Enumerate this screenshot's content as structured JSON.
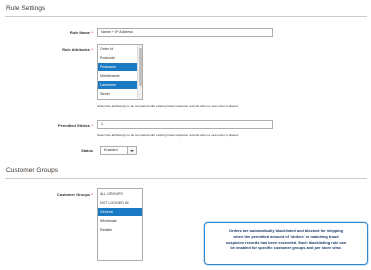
{
  "rule_settings": {
    "title": "Rule Settings",
    "rule_name": {
      "label": "Rule Name",
      "required": "*",
      "value": "Name + IP Address"
    },
    "rule_attributes": {
      "label": "Rule Attributes",
      "required": "*",
      "options": [
        {
          "text": "Order Id",
          "selected": false
        },
        {
          "text": "Postcode",
          "selected": false
        },
        {
          "text": "Firstname",
          "selected": true
        },
        {
          "text": "Middlename",
          "selected": false
        },
        {
          "text": "Lastname",
          "selected": true
        },
        {
          "text": "Street",
          "selected": false
        }
      ],
      "note": "Select the attribute(s) to be compared with existing fraud suspicion records when a new order is placed."
    },
    "permitted_strikes": {
      "label": "Permitted Strikes",
      "required": "*",
      "value": "1",
      "note": "Select the attribute(s) to be compared with existing fraud suspicion records when a new order is placed."
    },
    "status": {
      "label": "Status",
      "value": "Enabled"
    }
  },
  "customer_groups": {
    "title": "Customer Groups",
    "field": {
      "label": "Customer Groups",
      "required": "*",
      "options": [
        {
          "text": "ALL GROUPS",
          "selected": false
        },
        {
          "text": "NOT LOGGED IN",
          "selected": false
        },
        {
          "text": "General",
          "selected": true
        },
        {
          "text": "Wholesale",
          "selected": false
        },
        {
          "text": "Retailer",
          "selected": false
        }
      ]
    }
  },
  "tooltip": {
    "line1": "Orders are automatically blacklisted and blocked for shipping",
    "line2": "when the permitted amount of 'strikes' or matching fraud",
    "line3": "suspicion records has been exceeded. Each blacklisting rule can",
    "line4": "be enabled for specific customer groups and per store view."
  },
  "colors": {
    "selected_option_bg": "#1979c3",
    "required_mark": "#e22626",
    "tooltip_border": "#2e88d2",
    "tooltip_text": "#1b3a66"
  }
}
